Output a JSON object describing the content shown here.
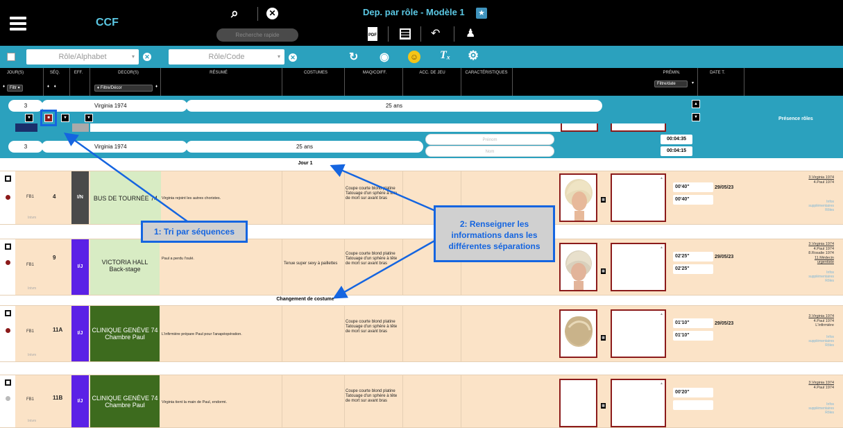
{
  "app": {
    "name": "CCF",
    "doc_title": "Dep. par rôle - Modèle 1",
    "quick_search": "Recherche rapide"
  },
  "filters": {
    "role_alpha": "Rôle/Alphabet",
    "role_code": "Rôle/Code"
  },
  "headers": {
    "jours": "JOUR(S)",
    "seq": "SÉQ.",
    "eff": "EFF.",
    "decor": "DECOR(S)",
    "resume": "RÉSUMÉ",
    "costumes": "COSTUMES",
    "magcoiff": "MAQ/COIFF.",
    "acc": "ACC. DE JEU",
    "caract": "CARACTÉRISTIQUES",
    "premin": "PRÉMIN.",
    "datet": "DATE T.",
    "filtr": "Filtr",
    "filtre_decor": "Filtre/Décor",
    "filtre_date": "Filtre/date"
  },
  "seqband": {
    "num": "3",
    "role": "Virginia 1974",
    "age": "25 ans",
    "presence": "Présence rôles"
  },
  "band2": {
    "num": "3",
    "role": "Virginia 1974",
    "age": "25 ans",
    "prenom": "Prénom",
    "nom": "Nom",
    "t1": "00:04:35",
    "t2": "00:04:15"
  },
  "labels": {
    "jour1": "Jour 1",
    "changement": "Changement de costume",
    "infos": "Infos supplémentaires Rôles"
  },
  "callouts": {
    "c1": "1: Tri par séquences",
    "c2": "2: Renseigner les informations dans les différentes séparations"
  },
  "rows": [
    {
      "fb": "FB1",
      "seq": "4",
      "eff": "I/N",
      "eff_color": "#4a4a4a",
      "decor": "BUS DE TOURNÉE 74",
      "decor_bg": "#d8ecc4",
      "decor_color": "#000",
      "resume": "Virginia rejoint les autres choristes.",
      "costume": "",
      "magic": "Coupe courte blond platine Tatouage d'un sphère à tête de mort sur avant bras",
      "t1": "00'40\"",
      "t2": "00'40\"",
      "date": "29/05/23",
      "roles": [
        "3.Virginia 1974",
        "4.Paul 1974"
      ]
    },
    {
      "fb": "FB1",
      "seq": "9",
      "eff": "I/J",
      "eff_color": "#5b21e6",
      "decor": "VICTORIA HALL Back-stage",
      "decor_bg": "#d8ecc4",
      "decor_color": "#000",
      "resume": "Paul a perdu l'oulé.",
      "costume": "Tenue super sexy à paillettes",
      "magic": "Coupe courte blond platine Tatouage d'un sphère à tête de mort sur avant bras",
      "t1": "02'25\"",
      "t2": "02'25\"",
      "date": "29/05/23",
      "roles": [
        "3.Virginia 1974",
        "4.Paul 1974",
        "8.Rosalie 1974",
        "11.Médecin urgentiste"
      ]
    },
    {
      "fb": "FB1",
      "seq": "11A",
      "eff": "I/J",
      "eff_color": "#5b21e6",
      "decor": "CLINIQUE GENÈVE 74 Chambre Paul",
      "decor_bg": "#3d6b1e",
      "decor_color": "#fff",
      "resume": "L'infirmière prépare Paul pour l'anapéopération.",
      "costume": "",
      "magic": "Coupe courte blond platine Tatouage d'un sphère à tête de mort sur avant bras",
      "t1": "01'10\"",
      "t2": "01'10\"",
      "date": "29/05/23",
      "roles": [
        "3.Virginia 1974",
        "4.Paul 1974",
        "L'infirmière"
      ]
    },
    {
      "fb": "FB1",
      "seq": "11B",
      "eff": "I/J",
      "eff_color": "#5b21e6",
      "decor": "CLINIQUE GENÈVE 74 Chambre Paul",
      "decor_bg": "#3d6b1e",
      "decor_color": "#fff",
      "resume": "Virginia tient la main de Paul, endormi.",
      "costume": "",
      "magic": "Coupe courte blond platine Tatouage d'un sphère à tête de mort sur avant bras",
      "t1": "00'20\"",
      "t2": "",
      "date": "",
      "roles": [
        "3.Virginia 1974",
        "4.Paul 1974"
      ]
    }
  ]
}
